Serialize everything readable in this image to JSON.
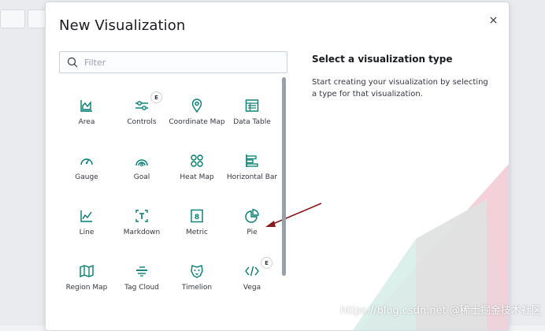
{
  "modal": {
    "title": "New Visualization",
    "search_placeholder": "Filter"
  },
  "tiles": [
    {
      "label": "Area",
      "icon": "area-chart-icon"
    },
    {
      "label": "Controls",
      "icon": "controls-icon",
      "badge": "E"
    },
    {
      "label": "Coordinate Map",
      "icon": "map-marker-icon"
    },
    {
      "label": "Data Table",
      "icon": "data-table-icon"
    },
    {
      "label": "Gauge",
      "icon": "gauge-icon"
    },
    {
      "label": "Goal",
      "icon": "goal-icon"
    },
    {
      "label": "Heat Map",
      "icon": "heat-map-icon"
    },
    {
      "label": "Horizontal Bar",
      "icon": "horizontal-bar-icon"
    },
    {
      "label": "Line",
      "icon": "line-chart-icon"
    },
    {
      "label": "Markdown",
      "icon": "markdown-icon"
    },
    {
      "label": "Metric",
      "icon": "metric-icon"
    },
    {
      "label": "Pie",
      "icon": "pie-chart-icon"
    },
    {
      "label": "Region Map",
      "icon": "region-map-icon"
    },
    {
      "label": "Tag Cloud",
      "icon": "tag-cloud-icon"
    },
    {
      "label": "Timelion",
      "icon": "timelion-icon"
    },
    {
      "label": "Vega",
      "icon": "code-icon",
      "badge": "E"
    }
  ],
  "side": {
    "title": "Select a visualization type",
    "description": "Start creating your visualization by selecting a type for that visualization."
  },
  "colors": {
    "icon": "#017d73",
    "arrow": "#8b1a1a",
    "pink": "#f1c7d1",
    "teal": "#d3ece7"
  },
  "watermark": "https://blog.csdn.net @稀土掘金技术社区"
}
